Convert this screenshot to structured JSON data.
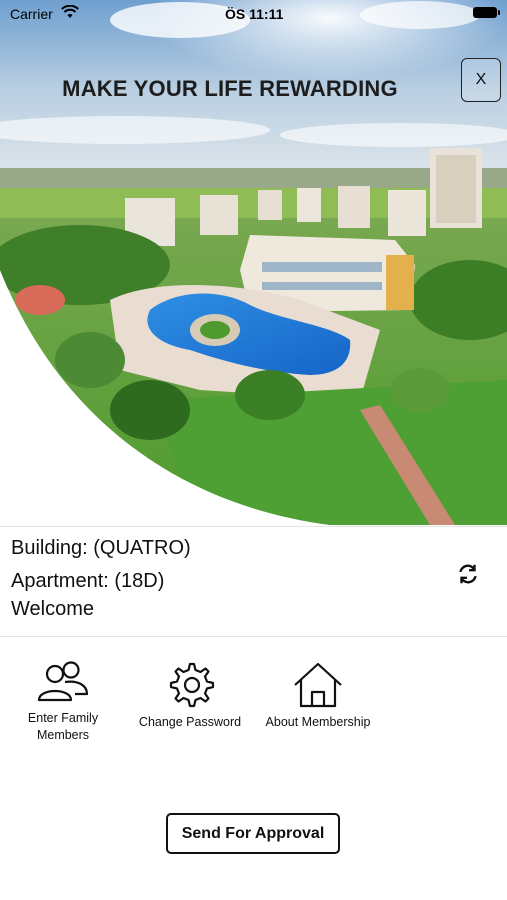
{
  "status_bar": {
    "carrier": "Carrier",
    "time": "ÖS 11:11"
  },
  "hero": {
    "headline": "MAKE YOUR LIFE REWARDING",
    "close_label": "X"
  },
  "info": {
    "building": "Building: (QUATRO)",
    "apartment": "Apartment: (18D)",
    "welcome": "Welcome"
  },
  "menu": {
    "items": [
      {
        "label_line1": "Enter Family",
        "label_line2": "Members",
        "icon": "people-icon"
      },
      {
        "label": "Change Password",
        "icon": "gear-icon"
      },
      {
        "label": "About Membership",
        "icon": "house-icon"
      }
    ]
  },
  "actions": {
    "send_label": "Send For Approval"
  }
}
